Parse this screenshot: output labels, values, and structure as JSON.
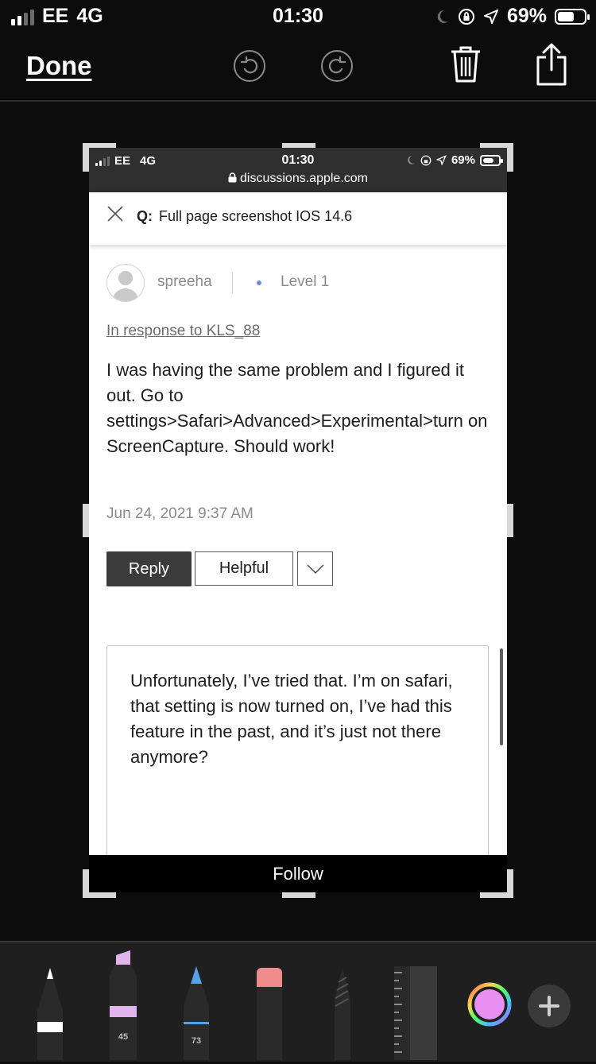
{
  "status_bar": {
    "carrier": "EE",
    "network": "4G",
    "time": "01:30",
    "battery": "69%"
  },
  "toolbar": {
    "done_label": "Done"
  },
  "screenshot": {
    "status_bar": {
      "carrier": "EE",
      "network": "4G",
      "time": "01:30",
      "battery": "69%",
      "url": "discussions.apple.com"
    },
    "question_bar": {
      "prefix": "Q:",
      "title": "Full page screenshot IOS 14.6"
    },
    "post": {
      "username": "spreeha",
      "level": "Level 1",
      "in_response_to": "In response to KLS_88",
      "body": "I was having the same problem and I figured it out. Go to settings>Safari>Advanced>Experimental>turn on ScreenCapture. Should work!",
      "date": "Jun 24, 2021 9:37 AM",
      "reply_label": "Reply",
      "helpful_label": "Helpful"
    },
    "reply_box": {
      "text": "Unfortunately, I’ve tried that. I’m on safari, that setting is now turned on, I’ve had this feature in the past, and it’s just not there anymore?"
    },
    "follow_label": "Follow"
  },
  "tools": [
    {
      "name": "pen",
      "color": "#ffffff"
    },
    {
      "name": "highlighter",
      "color": "#e9b0f0",
      "width_label": "45"
    },
    {
      "name": "pencil",
      "color": "#5aa0e8",
      "width_label": "73"
    },
    {
      "name": "eraser",
      "color": "#f08c8c"
    },
    {
      "name": "lasso"
    },
    {
      "name": "ruler"
    },
    {
      "name": "color-picker",
      "color": "#e98ff2"
    },
    {
      "name": "add"
    }
  ]
}
